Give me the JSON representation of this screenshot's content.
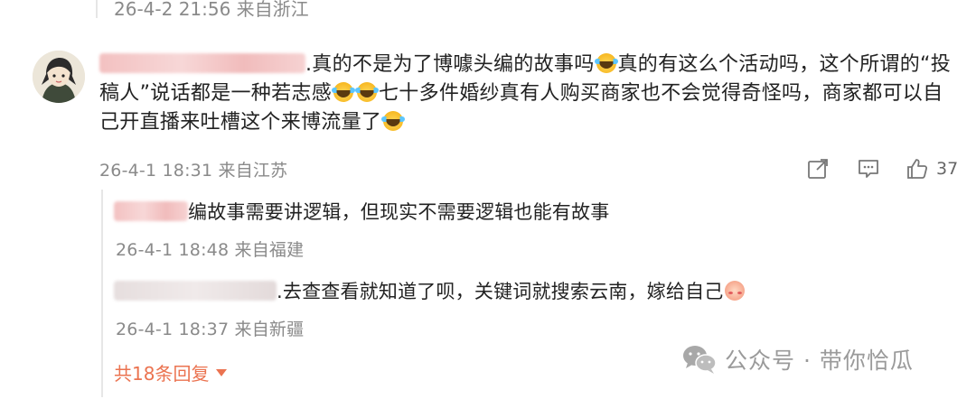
{
  "previous_reply": {
    "time_location": "26-4-2 21:56 来自浙江"
  },
  "comment": {
    "text_part1": ".真的不是为了博噱头编的故事吗",
    "text_part2": "真的有这么个活动吗，这个所谓的“投稿人”说话都是一种若志感",
    "text_part3": "七十多件婚纱真有人购买商家也不会觉得奇怪吗，商家都可以自己开直播来吐槽这个来博流量了",
    "time_location": "26-4-1 18:31 来自江苏",
    "like_count": "37"
  },
  "replies": [
    {
      "text": "编故事需要讲逻辑，但现实不需要逻辑也能有故事",
      "time_location": "26-4-1 18:48 来自福建"
    },
    {
      "text": ".去查查看就知道了呗，关键词就搜索云南，嫁给自己",
      "time_location": "26-4-1 18:37 来自新疆"
    }
  ],
  "more_replies_label": "共18条回复",
  "watermark": "公众号 · 带你恰瓜",
  "icons": [
    "share-icon",
    "comment-icon",
    "like-icon",
    "laugh-cry-emoji",
    "shy-emoji",
    "wechat-icon"
  ],
  "colors": {
    "accent": "#eb7350",
    "meta_gray": "#8a8a8a",
    "text": "#222222"
  }
}
